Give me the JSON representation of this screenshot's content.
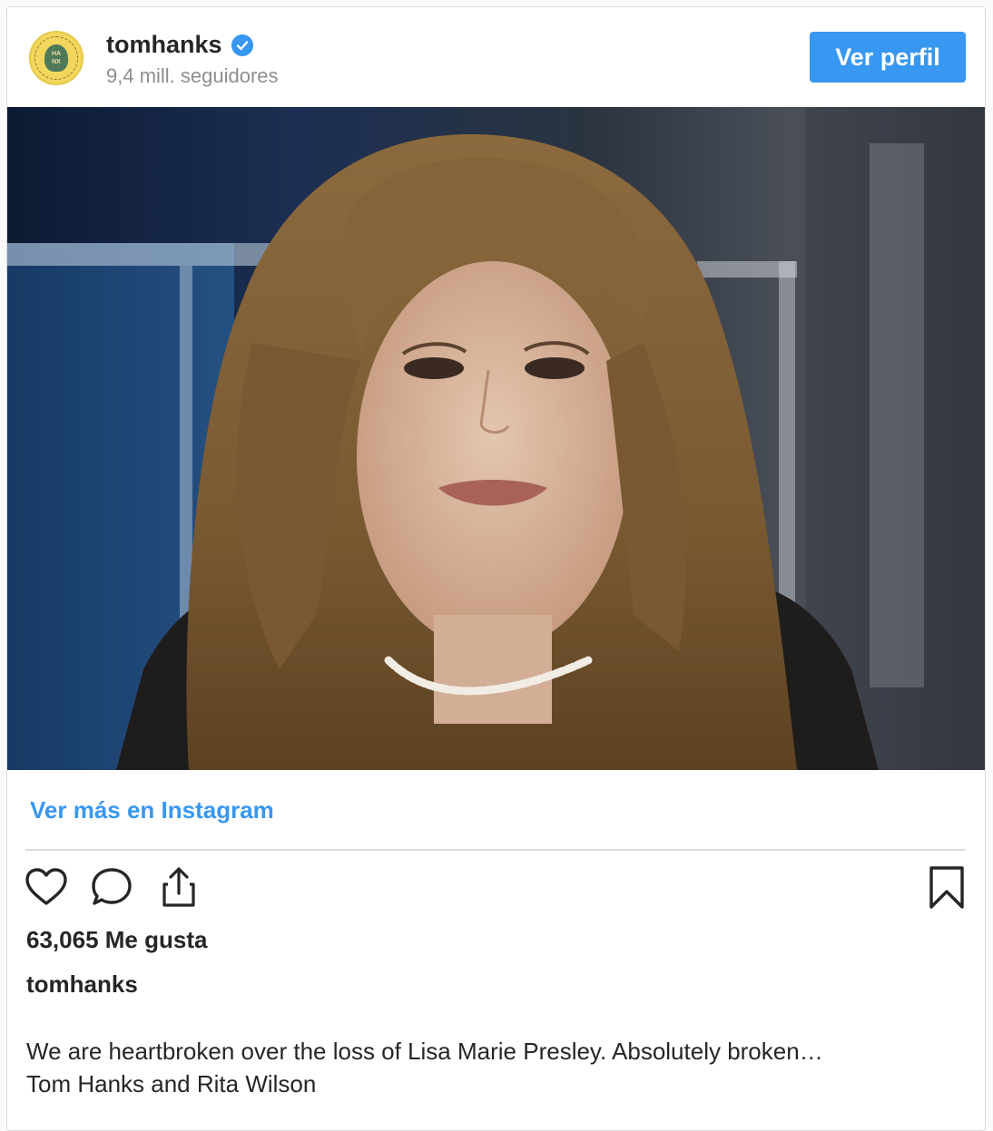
{
  "header": {
    "username": "tomhanks",
    "followers": "9,4 mill. seguidores",
    "profile_button": "Ver perfil",
    "avatar_text": "HA NX"
  },
  "post": {
    "view_more": "Ver más en Instagram",
    "likes": "63,065 Me gusta",
    "author": "tomhanks",
    "caption_line1": "We are heartbroken over the loss of Lisa Marie Presley. Absolutely broken…",
    "caption_line2": "Tom Hanks and Rita Wilson"
  },
  "icons": [
    "heart-icon",
    "comment-icon",
    "share-icon",
    "bookmark-icon",
    "verified-badge-icon"
  ],
  "colors": {
    "accent": "#3897f0",
    "text": "#262626",
    "muted": "#8e8e8e",
    "border": "#dbdbdb"
  }
}
